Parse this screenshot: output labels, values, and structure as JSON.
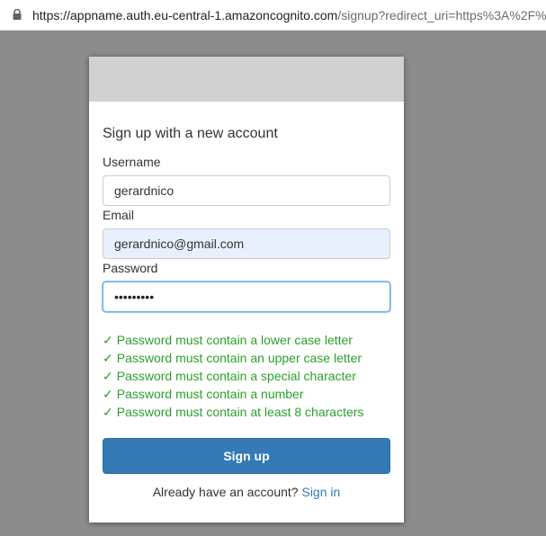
{
  "browser": {
    "url_main": "https://appname.auth.eu-central-1.amazoncognito.com",
    "url_rest": "/signup?redirect_uri=https%3A%2F%"
  },
  "form": {
    "title": "Sign up with a new account",
    "username_label": "Username",
    "username_value": "gerardnico",
    "email_label": "Email",
    "email_value": "gerardnico@gmail.com",
    "password_label": "Password",
    "password_value": "•••••••••"
  },
  "requirements": [
    {
      "mark": "✓",
      "text": "Password must contain a lower case letter"
    },
    {
      "mark": "✓",
      "text": "Password must contain an upper case letter"
    },
    {
      "mark": "✓",
      "text": "Password must contain a special character"
    },
    {
      "mark": "✓",
      "text": "Password must contain a number"
    },
    {
      "mark": "✓",
      "text": "Password must contain at least 8 characters"
    }
  ],
  "actions": {
    "signup_label": "Sign up",
    "signin_prompt": "Already have an account?",
    "signin_link": "Sign in"
  },
  "colors": {
    "primary": "#337ab7",
    "success": "#2ca02c",
    "banner": "#d1d1d1",
    "backdrop": "#8c8c8c"
  },
  "icons": {
    "address_bar": "lock-icon",
    "requirement": "check-icon"
  }
}
